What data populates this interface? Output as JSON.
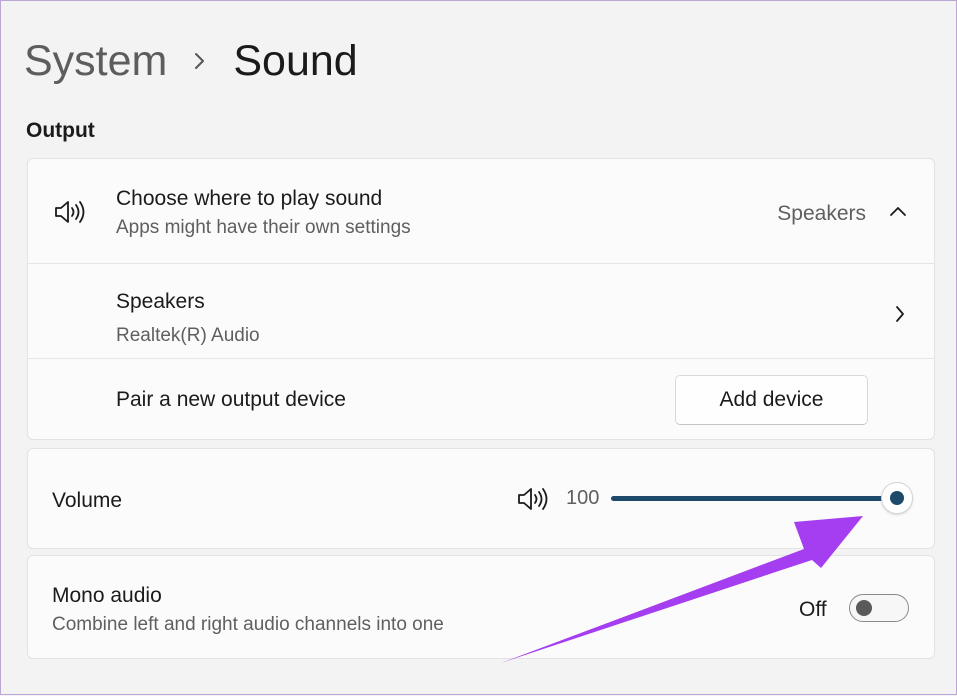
{
  "breadcrumb": {
    "parent": "System",
    "current": "Sound"
  },
  "section": {
    "output_label": "Output"
  },
  "output": {
    "choose": {
      "title": "Choose where to play sound",
      "subtitle": "Apps might have their own settings",
      "value": "Speakers"
    },
    "speakers": {
      "title": "Speakers",
      "subtitle": "Realtek(R) Audio"
    },
    "pair": {
      "title": "Pair a new output device",
      "button_label": "Add device"
    }
  },
  "volume": {
    "label": "Volume",
    "value": "100",
    "level_percent": 100
  },
  "mono": {
    "title": "Mono audio",
    "subtitle": "Combine left and right audio channels into one",
    "state": "Off"
  },
  "icons": {
    "speaker": "speaker-icon",
    "chevron_up": "chevron-up-icon",
    "chevron_right": "chevron-right-icon",
    "breadcrumb_chevron": "chevron-right-icon"
  },
  "colors": {
    "accent": "#1d4a6b",
    "annotation_arrow": "#a53ef0",
    "background": "#f3f3f3",
    "card": "#fbfbfb"
  }
}
